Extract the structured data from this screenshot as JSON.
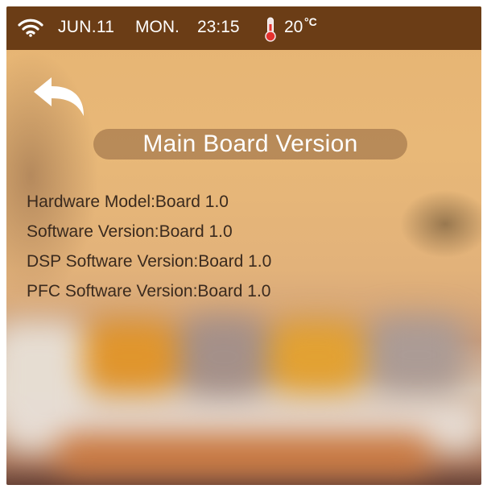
{
  "status_bar": {
    "wifi_icon": "wifi-icon",
    "date": "JUN.11",
    "day": "MON.",
    "time": "23:15",
    "thermometer_icon": "thermometer-icon",
    "temperature": "20",
    "temperature_unit": "°C"
  },
  "header": {
    "back_icon": "back-arrow-icon",
    "title": "Main Board Version"
  },
  "info": [
    {
      "label": "Hardware  Model:Board 1.0"
    },
    {
      "label": "Software Version:Board 1.0"
    },
    {
      "label": "DSP Software Version:Board 1.0"
    },
    {
      "label": "PFC Software Version:Board 1.0"
    }
  ],
  "colors": {
    "status_bar_bg": "#6b3d16",
    "title_pill_bg": "#b08454",
    "text_dark": "#3a2a1e"
  }
}
